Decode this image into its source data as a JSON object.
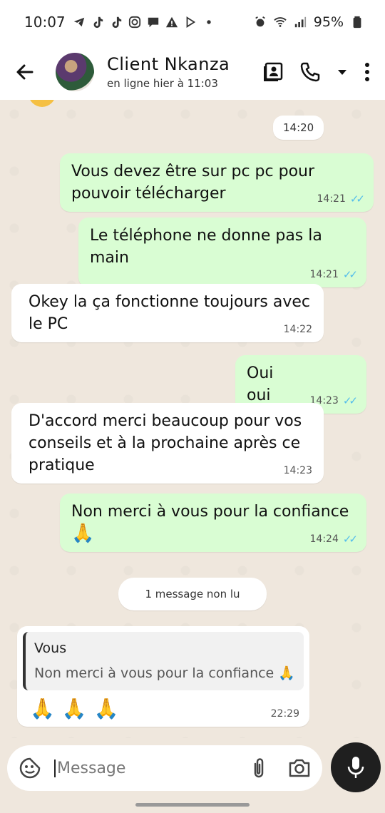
{
  "status_bar": {
    "time": "10:07",
    "battery": "95%",
    "icons": [
      "telegram-icon",
      "tiktok-icon",
      "tiktok-icon",
      "instagram-icon",
      "chat-icon",
      "warning-icon",
      "play-icon",
      "dot-icon",
      "alarm-icon",
      "wifi-icon",
      "signal-icon",
      "battery-icon"
    ]
  },
  "header": {
    "contact_name": "Client Nkanza",
    "last_seen": "en ligne hier à 11:03"
  },
  "messages": [
    {
      "type": "time_pill",
      "text": "14:20"
    },
    {
      "type": "out",
      "text_line1": "Vous devez être sur pc pc pour",
      "text_line2": "pouvoir télécharger",
      "time": "14:21"
    },
    {
      "type": "out",
      "text": "Le téléphone ne donne pas la main",
      "time": "14:21"
    },
    {
      "type": "in",
      "text_line1": "Okey la ça fonctionne toujours avec",
      "text_line2": "le PC",
      "time": "14:22"
    },
    {
      "type": "out",
      "text": "Oui oui",
      "time": "14:23"
    },
    {
      "type": "in",
      "text_line1": "D'accord merci beaucoup pour vos",
      "text_line2": "conseils et à la prochaine après ce",
      "text_line3": "pratique",
      "time": "14:23"
    },
    {
      "type": "out",
      "text": "Non merci à vous pour la confiance",
      "emoji": "🙏",
      "time": "14:24"
    },
    {
      "type": "unread",
      "text": "1 message non lu"
    },
    {
      "type": "in_reply",
      "quote_author": "Vous",
      "quote_text": "Non merci à vous pour la confiance 🙏",
      "text": "🙏🙏🙏",
      "time": "22:29"
    }
  ],
  "input": {
    "placeholder": "Message"
  },
  "colors": {
    "outgoing_bubble": "#d9fdd3",
    "incoming_bubble": "#ffffff",
    "read_ticks": "#53bdeb",
    "chat_background": "#efe7dd"
  }
}
